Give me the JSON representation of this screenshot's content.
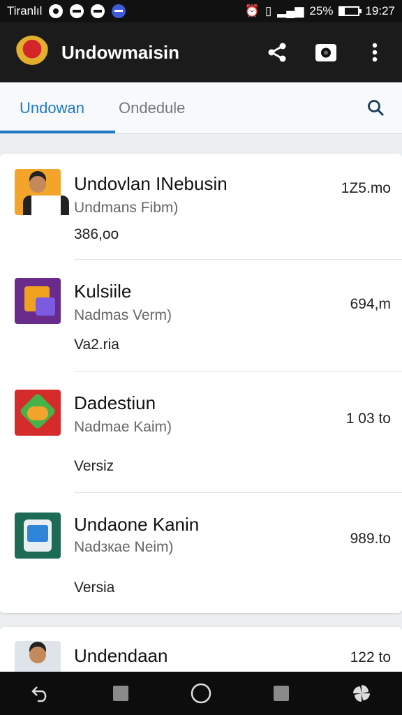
{
  "status_bar": {
    "carrier": "Tiranlıl",
    "battery_percent": "25%",
    "time": "19:27",
    "battery_level": 0.25
  },
  "app_bar": {
    "title": "Undowmaisin",
    "icons": [
      "garuda-logo-icon",
      "share-icon",
      "camera-icon",
      "more-vert-icon"
    ]
  },
  "tabs": {
    "items": [
      {
        "label": "Undowan",
        "active": true
      },
      {
        "label": "Ondedule",
        "active": false
      }
    ],
    "search_icon": "search-icon",
    "accent_color": "#1e7ac8"
  },
  "list": {
    "items": [
      {
        "name": "Undovlan INebusin",
        "subtitle": "Undmans Fibm)",
        "version": "386,oo",
        "size": "1Z5.mo",
        "icon": "person-avatar-icon"
      },
      {
        "name": "Kulsiile",
        "subtitle": "Nadmas Verm)",
        "version": "Va2.ria",
        "size": "694,m",
        "icon": "chat-app-icon"
      },
      {
        "name": "Dadestiun",
        "subtitle": "Nadmae Kaim)",
        "version": "Versiz",
        "size": "1 03 to",
        "icon": "play-app-icon"
      },
      {
        "name": "Undaone Kanin",
        "subtitle": "Nadзкae Neim)",
        "version": "Versia",
        "size": "989.to",
        "icon": "browser-app-icon"
      },
      {
        "name": "Undendaan",
        "subtitle": "",
        "version": "",
        "size": "122 to",
        "icon": "person-avatar-icon"
      }
    ]
  },
  "nav_bar": {
    "icons": [
      "back-icon",
      "square-icon",
      "home-circle-icon",
      "recents-square-icon",
      "pinwheel-icon"
    ]
  }
}
